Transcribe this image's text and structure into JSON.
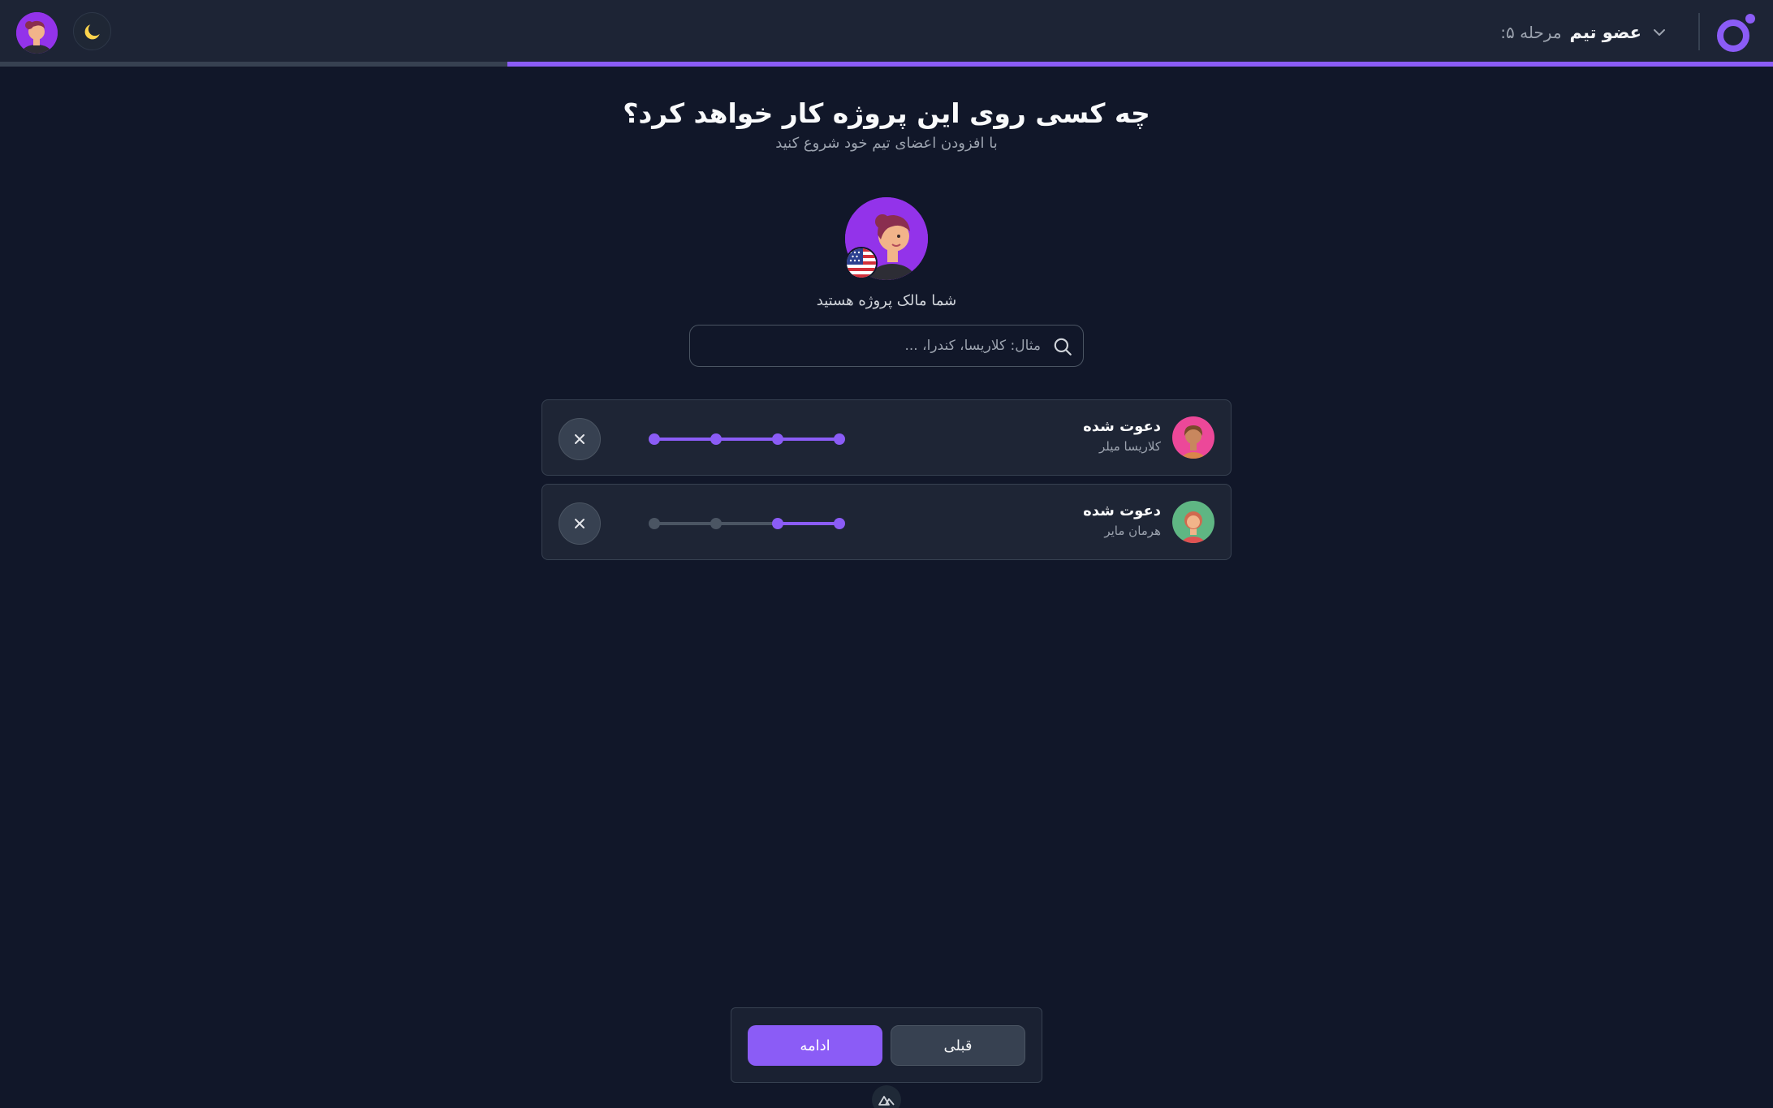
{
  "header": {
    "step_label": "مرحله ۵:",
    "step_name": "عضو تیم",
    "progress_fraction": 0.714
  },
  "main": {
    "title": "چه کسی روی این پروژه کار خواهد کرد؟",
    "subtitle": "با افزودن اعضای تیم خود شروع کنید",
    "owner_label": "شما مالک پروژه هستید",
    "search_placeholder": "مثال: کلاریسا، کندرا، ..."
  },
  "members": [
    {
      "status": "دعوت شده",
      "name": "کلاریسا میلر",
      "avatar_color": "#ec4899",
      "level": 4
    },
    {
      "status": "دعوت شده",
      "name": "هرمان مایر",
      "avatar_color": "#5fb683",
      "level": 2
    }
  ],
  "footer": {
    "continue_label": "ادامه",
    "previous_label": "قبلی"
  },
  "colors": {
    "accent": "#8b5cf6",
    "background": "#111729",
    "card": "#1e2535"
  },
  "icons": [
    "logo-icon",
    "chevron-down-icon",
    "moon-icon",
    "search-icon",
    "close-icon",
    "flag-us-icon",
    "nuxt-icon"
  ]
}
